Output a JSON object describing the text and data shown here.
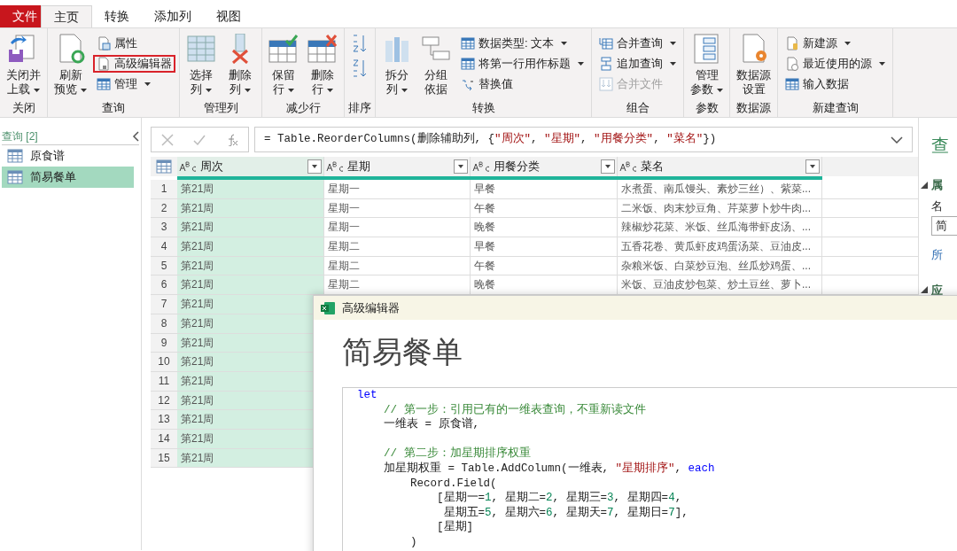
{
  "tabs": [
    {
      "label": "文件",
      "kind": "file",
      "selected": false
    },
    {
      "label": "主页",
      "kind": "tab",
      "selected": true
    },
    {
      "label": "转换",
      "kind": "tab",
      "selected": false
    },
    {
      "label": "添加列",
      "kind": "tab",
      "selected": false
    },
    {
      "label": "视图",
      "kind": "tab",
      "selected": false
    }
  ],
  "ribbon": [
    {
      "label": "关闭",
      "items": [
        {
          "kind": "large",
          "lines": [
            "关闭并",
            "上载"
          ],
          "dropdown": true
        }
      ]
    },
    {
      "label": "查询",
      "items": [
        {
          "kind": "large",
          "lines": [
            "刷新",
            "预览"
          ],
          "dropdown": true
        },
        {
          "kind": "stack",
          "items": [
            {
              "label": "属性",
              "dropdown": false,
              "disabled": false,
              "highlighted": false
            },
            {
              "label": "高级编辑器",
              "dropdown": false,
              "disabled": false,
              "highlighted": true
            },
            {
              "label": "管理",
              "dropdown": true,
              "disabled": false,
              "highlighted": false
            }
          ]
        }
      ]
    },
    {
      "label": "管理列",
      "items": [
        {
          "kind": "large",
          "lines": [
            "选择",
            "列"
          ],
          "dropdown": true
        },
        {
          "kind": "large",
          "lines": [
            "删除",
            "列"
          ],
          "dropdown": true
        }
      ]
    },
    {
      "label": "减少行",
      "items": [
        {
          "kind": "large",
          "lines": [
            "保留",
            "行"
          ],
          "dropdown": true
        },
        {
          "kind": "large",
          "lines": [
            "删除",
            "行"
          ],
          "dropdown": true
        }
      ]
    },
    {
      "label": "排序",
      "items": [
        {
          "kind": "iconstack"
        }
      ]
    },
    {
      "label": "转换",
      "items": [
        {
          "kind": "large",
          "lines": [
            "拆分",
            "列"
          ],
          "dropdown": true
        },
        {
          "kind": "large",
          "lines": [
            "分组",
            "依据"
          ],
          "dropdown": false
        },
        {
          "kind": "stack",
          "items": [
            {
              "label": "数据类型: 文本",
              "dropdown": true,
              "disabled": false,
              "highlighted": false
            },
            {
              "label": "将第一行用作标题",
              "dropdown": true,
              "disabled": false,
              "highlighted": false
            },
            {
              "label": "替换值",
              "dropdown": false,
              "disabled": false,
              "highlighted": false
            }
          ]
        }
      ]
    },
    {
      "label": "组合",
      "items": [
        {
          "kind": "stack",
          "items": [
            {
              "label": "合并查询",
              "dropdown": true,
              "disabled": false,
              "highlighted": false
            },
            {
              "label": "追加查询",
              "dropdown": true,
              "disabled": false,
              "highlighted": false
            },
            {
              "label": "合并文件",
              "dropdown": false,
              "disabled": true,
              "highlighted": false
            }
          ]
        }
      ]
    },
    {
      "label": "参数",
      "items": [
        {
          "kind": "large",
          "lines": [
            "管理",
            "参数"
          ],
          "dropdown": true
        }
      ]
    },
    {
      "label": "数据源",
      "items": [
        {
          "kind": "large",
          "lines": [
            "数据源",
            "设置"
          ],
          "dropdown": false
        }
      ]
    },
    {
      "label": "新建查询",
      "items": [
        {
          "kind": "stack",
          "items": [
            {
              "label": "新建源",
              "dropdown": true,
              "disabled": false,
              "highlighted": false
            },
            {
              "label": "最近使用的源",
              "dropdown": true,
              "disabled": false,
              "highlighted": false
            },
            {
              "label": "输入数据",
              "dropdown": false,
              "disabled": false,
              "highlighted": false
            }
          ]
        }
      ]
    }
  ],
  "queries": {
    "title": "查询 [2]",
    "items": [
      {
        "label": "原食谱",
        "selected": false
      },
      {
        "label": "简易餐单",
        "selected": true
      }
    ]
  },
  "formula": [
    {
      "kind": "plain",
      "text": "= Table.ReorderColumns(删除辅助列, {"
    },
    {
      "kind": "string",
      "text": "\"周次\""
    },
    {
      "kind": "plain",
      "text": ", "
    },
    {
      "kind": "string",
      "text": "\"星期\""
    },
    {
      "kind": "plain",
      "text": ", "
    },
    {
      "kind": "string",
      "text": "\"用餐分类\""
    },
    {
      "kind": "plain",
      "text": ", "
    },
    {
      "kind": "string",
      "text": "\"菜名\""
    },
    {
      "kind": "plain",
      "text": "})"
    }
  ],
  "table": {
    "columns": [
      {
        "label": "周次",
        "selected": true
      },
      {
        "label": "星期",
        "selected": false
      },
      {
        "label": "用餐分类",
        "selected": false
      },
      {
        "label": "菜名",
        "selected": false
      }
    ],
    "rows": [
      {
        "n": "1",
        "cells": [
          "第21周",
          "星期一",
          "早餐",
          "水煮蛋、南瓜馒头、素炒三丝）、紫菜..."
        ]
      },
      {
        "n": "2",
        "cells": [
          "第21周",
          "星期一",
          "午餐",
          "二米饭、肉末炒豆角、芹菜萝卜炒牛肉..."
        ]
      },
      {
        "n": "3",
        "cells": [
          "第21周",
          "星期一",
          "晚餐",
          "辣椒炒花菜、米饭、丝瓜海带虾皮汤、..."
        ]
      },
      {
        "n": "4",
        "cells": [
          "第21周",
          "星期二",
          "早餐",
          "五香花卷、黄瓜虾皮鸡蛋汤菜、豆油皮..."
        ]
      },
      {
        "n": "5",
        "cells": [
          "第21周",
          "星期二",
          "午餐",
          "杂粮米饭、白菜炒豆泡、丝瓜炒鸡蛋、..."
        ]
      },
      {
        "n": "6",
        "cells": [
          "第21周",
          "星期二",
          "晚餐",
          "米饭、豆油皮炒包菜、炒土豆丝、萝卜..."
        ]
      },
      {
        "n": "7",
        "cells": [
          "第21周"
        ]
      },
      {
        "n": "8",
        "cells": [
          "第21周"
        ]
      },
      {
        "n": "9",
        "cells": [
          "第21周"
        ]
      },
      {
        "n": "10",
        "cells": [
          "第21周"
        ]
      },
      {
        "n": "11",
        "cells": [
          "第21周"
        ]
      },
      {
        "n": "12",
        "cells": [
          "第21周"
        ]
      },
      {
        "n": "13",
        "cells": [
          "第21周"
        ]
      },
      {
        "n": "14",
        "cells": [
          "第21周"
        ]
      },
      {
        "n": "15",
        "cells": [
          "第21周"
        ]
      }
    ]
  },
  "settings": {
    "title": "查",
    "section_1": "属",
    "name_label": "名",
    "name_value": "简",
    "link": "所",
    "section_2": "应"
  },
  "editor": {
    "window_title": "高级编辑器",
    "heading": "简易餐单",
    "lines": [
      {
        "kind": "code",
        "segments": [
          {
            "kind": "keyword",
            "text": "let"
          }
        ]
      },
      {
        "kind": "code",
        "segments": [
          {
            "kind": "comment",
            "text": "    // 第一步：引用已有的一维表查询，不重新读文件"
          }
        ]
      },
      {
        "kind": "code",
        "segments": [
          {
            "kind": "plain",
            "text": "    一维表 = 原食谱,"
          }
        ]
      },
      {
        "kind": "blank"
      },
      {
        "kind": "code",
        "segments": [
          {
            "kind": "comment",
            "text": "    // 第二步：加星期排序权重"
          }
        ]
      },
      {
        "kind": "code",
        "segments": [
          {
            "kind": "plain",
            "text": "    加星期权重 = Table.AddColumn(一维表, "
          },
          {
            "kind": "string",
            "text": "\"星期排序\""
          },
          {
            "kind": "plain",
            "text": ", "
          },
          {
            "kind": "keyword",
            "text": "each"
          }
        ]
      },
      {
        "kind": "code",
        "segments": [
          {
            "kind": "plain",
            "text": "        Record.Field("
          }
        ]
      },
      {
        "kind": "code",
        "segments": [
          {
            "kind": "plain",
            "text": "            [星期一="
          },
          {
            "kind": "number",
            "text": "1"
          },
          {
            "kind": "plain",
            "text": ", 星期二="
          },
          {
            "kind": "number",
            "text": "2"
          },
          {
            "kind": "plain",
            "text": ", 星期三="
          },
          {
            "kind": "number",
            "text": "3"
          },
          {
            "kind": "plain",
            "text": ", 星期四="
          },
          {
            "kind": "number",
            "text": "4"
          },
          {
            "kind": "plain",
            "text": ","
          }
        ]
      },
      {
        "kind": "code",
        "segments": [
          {
            "kind": "plain",
            "text": "             星期五="
          },
          {
            "kind": "number",
            "text": "5"
          },
          {
            "kind": "plain",
            "text": ", 星期六="
          },
          {
            "kind": "number",
            "text": "6"
          },
          {
            "kind": "plain",
            "text": ", 星期天="
          },
          {
            "kind": "number",
            "text": "7"
          },
          {
            "kind": "plain",
            "text": ", 星期日="
          },
          {
            "kind": "number",
            "text": "7"
          },
          {
            "kind": "plain",
            "text": "],"
          }
        ]
      },
      {
        "kind": "code",
        "segments": [
          {
            "kind": "plain",
            "text": "            [星期]"
          }
        ]
      },
      {
        "kind": "code",
        "segments": [
          {
            "kind": "plain",
            "text": "        )"
          }
        ]
      }
    ]
  }
}
